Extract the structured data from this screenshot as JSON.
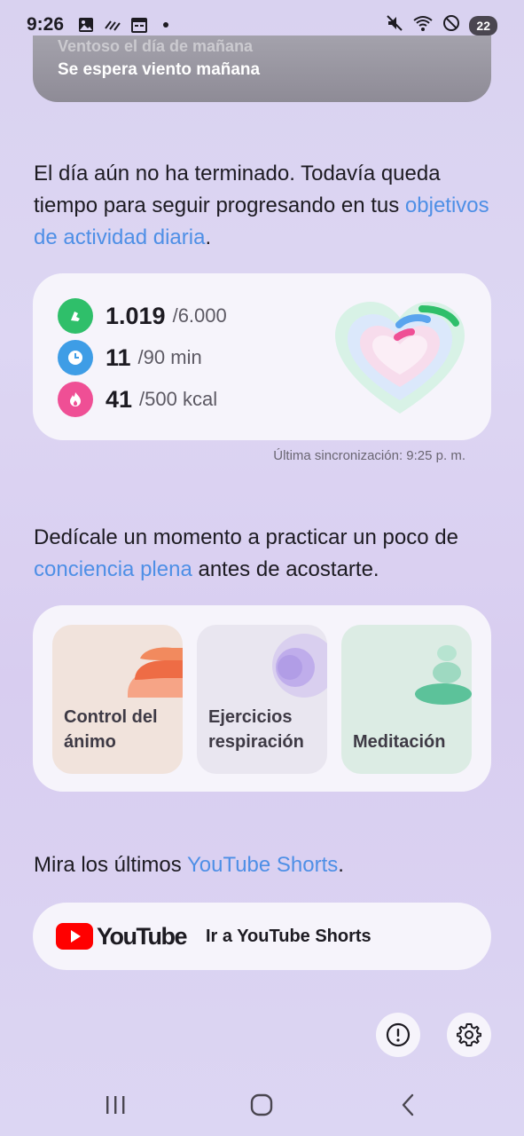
{
  "status_bar": {
    "time": "9:26",
    "battery": "22",
    "icons": [
      "gallery-icon",
      "signal-icon",
      "calendar-icon",
      "dot-icon",
      "mute-icon",
      "wifi-icon",
      "dnd-icon"
    ]
  },
  "weather": {
    "faded_text": "Ventoso el día de mañana",
    "message": "Se espera viento mañana"
  },
  "activity_intro": {
    "text": "El día aún no ha terminado. Todavía queda tiempo para seguir progresando en tus ",
    "link": "objetivos de actividad diaria",
    "suffix": "."
  },
  "activity": {
    "steps": {
      "value": "1.019",
      "goal": "/6.000",
      "color": "#2fbf6a"
    },
    "minutes": {
      "value": "11",
      "goal": "/90 min",
      "color": "#3e9de6"
    },
    "calories": {
      "value": "41",
      "goal": "/500 kcal",
      "color": "#ef4f95"
    },
    "sync": "Última sincronización: 9:25 p. m."
  },
  "mindfulness_intro": {
    "text": "Dedícale un momento a practicar un poco de ",
    "link": "conciencia plena",
    "suffix": " antes de acostarte."
  },
  "mindfulness": {
    "tiles": [
      {
        "label_line1": "Control del",
        "label_line2": "ánimo",
        "bg": "#f1e3dc"
      },
      {
        "label_line1": "Ejercicios",
        "label_line2": "respiración",
        "bg": "#e9e6f0"
      },
      {
        "label_line1": "",
        "label_line2": "Meditación",
        "bg": "#dcece4"
      }
    ]
  },
  "youtube_intro": {
    "text": "Mira los últimos ",
    "link": "YouTube Shorts",
    "suffix": "."
  },
  "youtube": {
    "wordmark": "YouTube",
    "action": "Ir a YouTube Shorts"
  },
  "colors": {
    "link": "#4e8fe6",
    "card_bg": "#f6f4fb"
  }
}
